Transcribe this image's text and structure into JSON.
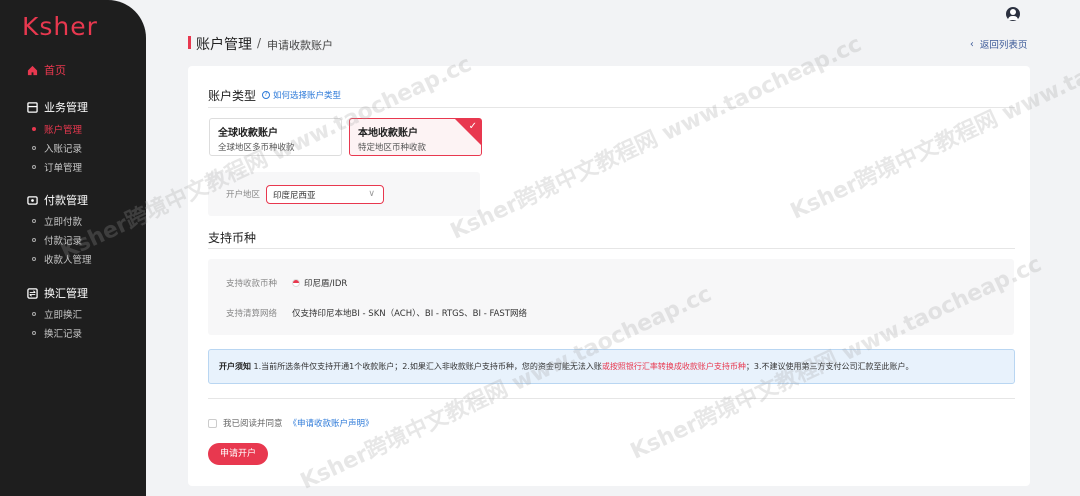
{
  "brand": "Ksher",
  "nav": {
    "home": "首页",
    "groups": [
      {
        "label": "业务管理",
        "items": [
          "账户管理",
          "入账记录",
          "订单管理"
        ]
      },
      {
        "label": "付款管理",
        "items": [
          "立即付款",
          "付款记录",
          "收款人管理"
        ]
      },
      {
        "label": "换汇管理",
        "items": [
          "立即换汇",
          "换汇记录"
        ]
      }
    ],
    "active_item": "账户管理"
  },
  "breadcrumb": {
    "title": "账户管理",
    "separator": "/",
    "sub": "申请收款账户"
  },
  "back_link": "返回列表页",
  "account_type": {
    "title": "账户类型",
    "help_link": "如何选择账户类型",
    "options": [
      {
        "name": "全球收款账户",
        "desc": "全球地区多币种收款",
        "selected": false
      },
      {
        "name": "本地收款账户",
        "desc": "特定地区币种收款",
        "selected": true
      }
    ]
  },
  "region": {
    "label": "开户地区",
    "value": "印度尼西亚"
  },
  "currency": {
    "title": "支持币种",
    "currency_label": "支持收款币种",
    "currency_value": "印尼盾/IDR",
    "network_label": "支持清算网络",
    "network_value": "仅支持印尼本地BI - SKN（ACH）、BI - RTGS、BI - FAST网络"
  },
  "notice": {
    "title": "开户须知",
    "part1": "1.当前所选条件仅支持开通1个收款账户；2.如果汇入非收款账户支持币种，您的资金可能无法入账",
    "warn": "或按照银行汇率转换成收款账户支持币种",
    "part2": "；3.不建议使用第三方支付公司汇款至此账户。"
  },
  "agreement": {
    "text": "我已阅读并同意",
    "link": "《申请收款账户声明》"
  },
  "submit_label": "申请开户",
  "watermark": "Ksher跨境中文教程网 www.taocheap.cc",
  "colors": {
    "accent": "#e8384f",
    "sidebar": "#1e1e1e",
    "link": "#2f7bd9"
  }
}
